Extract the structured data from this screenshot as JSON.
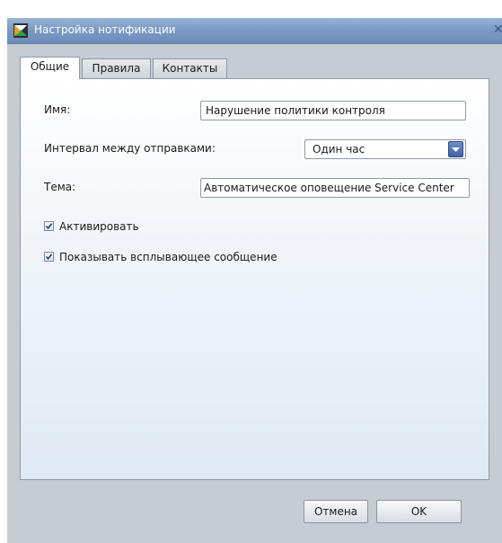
{
  "window": {
    "title": "Настройка нотификации",
    "icon": "app-logo-icon",
    "close_icon": "close-icon"
  },
  "tabs": [
    {
      "label": "Общие",
      "active": true
    },
    {
      "label": "Правила",
      "active": false
    },
    {
      "label": "Контакты",
      "active": false
    }
  ],
  "form": {
    "name_label": "Имя:",
    "name_value": "Нарушение политики контроля",
    "interval_label": "Интервал между отправками:",
    "interval_value": "Один час",
    "subject_label": "Тема:",
    "subject_value": "Автоматическое оповещение Service Center",
    "activate_label": "Активировать",
    "activate_checked": true,
    "popup_label": "Показывать всплывающее сообщение",
    "popup_checked": true
  },
  "buttons": {
    "cancel_label": "Отмена",
    "ok_label": "OK"
  },
  "colors": {
    "title_bar": "#7c9ac4",
    "dialog_background": "#c6ccd2",
    "dropdown_accent": "#3f62a6"
  }
}
